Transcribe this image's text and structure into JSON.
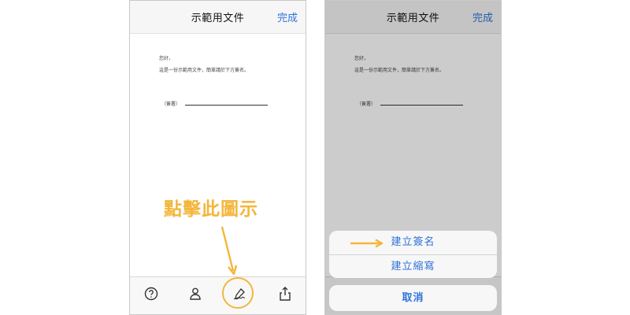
{
  "left_phone": {
    "nav": {
      "title": "示範用文件",
      "done": "完成"
    },
    "document": {
      "greeting": "您好，",
      "body": "這是一份示範用文件，簡單請於下方簽名。",
      "signature_label": "（簽署）"
    },
    "toolbar": {
      "items": [
        {
          "icon": "help-icon"
        },
        {
          "icon": "person-icon"
        },
        {
          "icon": "signature-icon"
        },
        {
          "icon": "share-icon"
        }
      ]
    }
  },
  "right_phone": {
    "nav": {
      "title": "示範用文件",
      "done": "完成"
    },
    "document": {
      "greeting": "您好，",
      "body": "這是一份示範用文件，簡單請於下方簽名。",
      "signature_label": "（簽署）"
    },
    "action_sheet": {
      "create_signature": "建立簽名",
      "create_initials": "建立縮寫",
      "cancel": "取消"
    }
  },
  "annotation": {
    "callout_text": "點擊此圖示",
    "color": "#f3b63b"
  },
  "colors": {
    "accent": "#2f73d8",
    "highlight": "#f3b63b"
  }
}
